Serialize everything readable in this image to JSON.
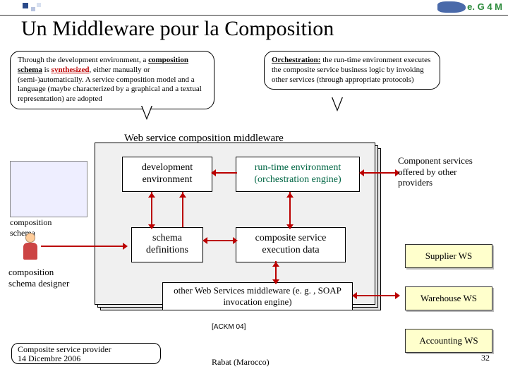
{
  "logo": "e. G 4 M",
  "title": "Un Middleware pour la Composition",
  "callout1_html": "Through the development environment, a <span class='u'><b>composition schema</b></span> is <span class='u red'><b>synthesized</b></span>, either manually or (semi-)automatically. A service composition model and a language (maybe characterized by a graphical and a textual representation) are adopted",
  "callout2_html": "<span class='u'><b>Orchestration:</b></span> the run-time environment executes the composite service business logic by invoking other services (through appropriate protocols)",
  "mw_label": "Web service composition middleware",
  "box_dev": "development environment",
  "box_rt": "run-time environment (orchestration engine)",
  "box_schdef": "schema definitions",
  "box_exec": "composite service execution data",
  "box_other": "other Web Services middleware (e. g. , SOAP invocation engine)",
  "schema_lbl": "composition\nschema",
  "designer_lbl": "composition schema designer",
  "side0": "Component services offered by other providers",
  "ws1": "Supplier WS",
  "ws2": "Warehouse WS",
  "ws3": "Accounting WS",
  "citation": "[ACKM 04]",
  "provider": "Composite service provider",
  "footer_date": "14 Dicembre 2006",
  "footer_center": "Rabat (Marocco)",
  "page_num": "32"
}
